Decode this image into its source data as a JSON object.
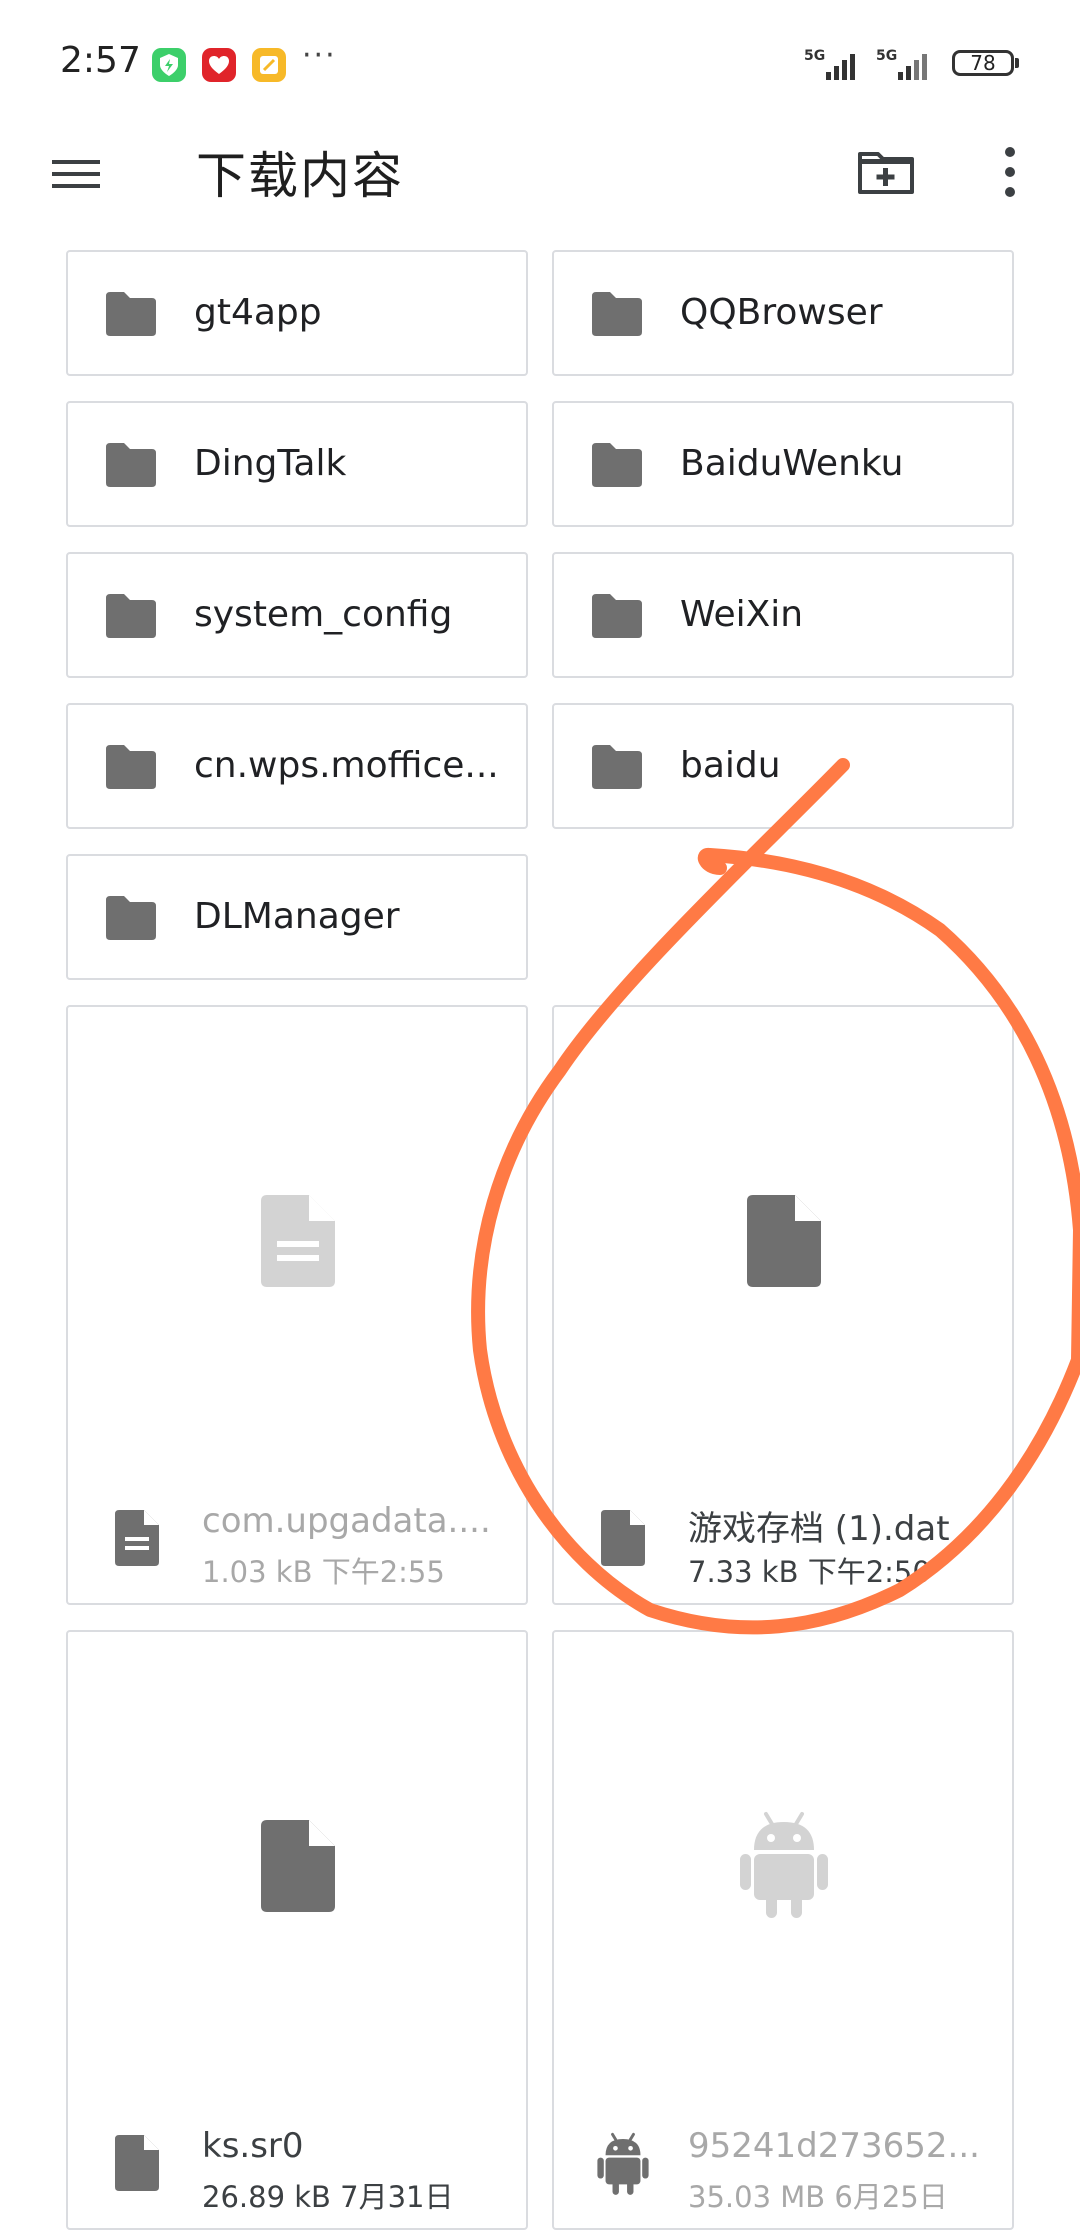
{
  "status_bar": {
    "time": "2:57",
    "more_dots": "···",
    "signal_1_label": "5G",
    "signal_2_label": "5G",
    "battery_level": "78"
  },
  "toolbar": {
    "title": "下载内容"
  },
  "folders": [
    {
      "name": "gt4app"
    },
    {
      "name": "QQBrowser"
    },
    {
      "name": "DingTalk"
    },
    {
      "name": "BaiduWenku"
    },
    {
      "name": "system_config"
    },
    {
      "name": "WeiXin"
    },
    {
      "name": "cn.wps.moffice..."
    },
    {
      "name": "baidu"
    },
    {
      "name": "DLManager"
    }
  ],
  "files": [
    {
      "name": "com.upgadata....",
      "meta": "1.03 kB  下午2:55",
      "icon": "text-file-icon"
    },
    {
      "name": "游戏存档 (1).dat",
      "meta": "7.33 kB  下午2:50",
      "icon": "file-icon"
    },
    {
      "name": "ks.sr0",
      "meta": "26.89 kB  7月31日",
      "icon": "file-icon"
    },
    {
      "name": "95241d273652...",
      "meta": "35.03 MB  6月25日",
      "icon": "android-icon"
    }
  ],
  "colors": {
    "annotation_stroke": "#FF7A45",
    "icon_dark": "#6f6f6f",
    "icon_light": "#d3d3d3",
    "card_border": "#dadce0"
  }
}
